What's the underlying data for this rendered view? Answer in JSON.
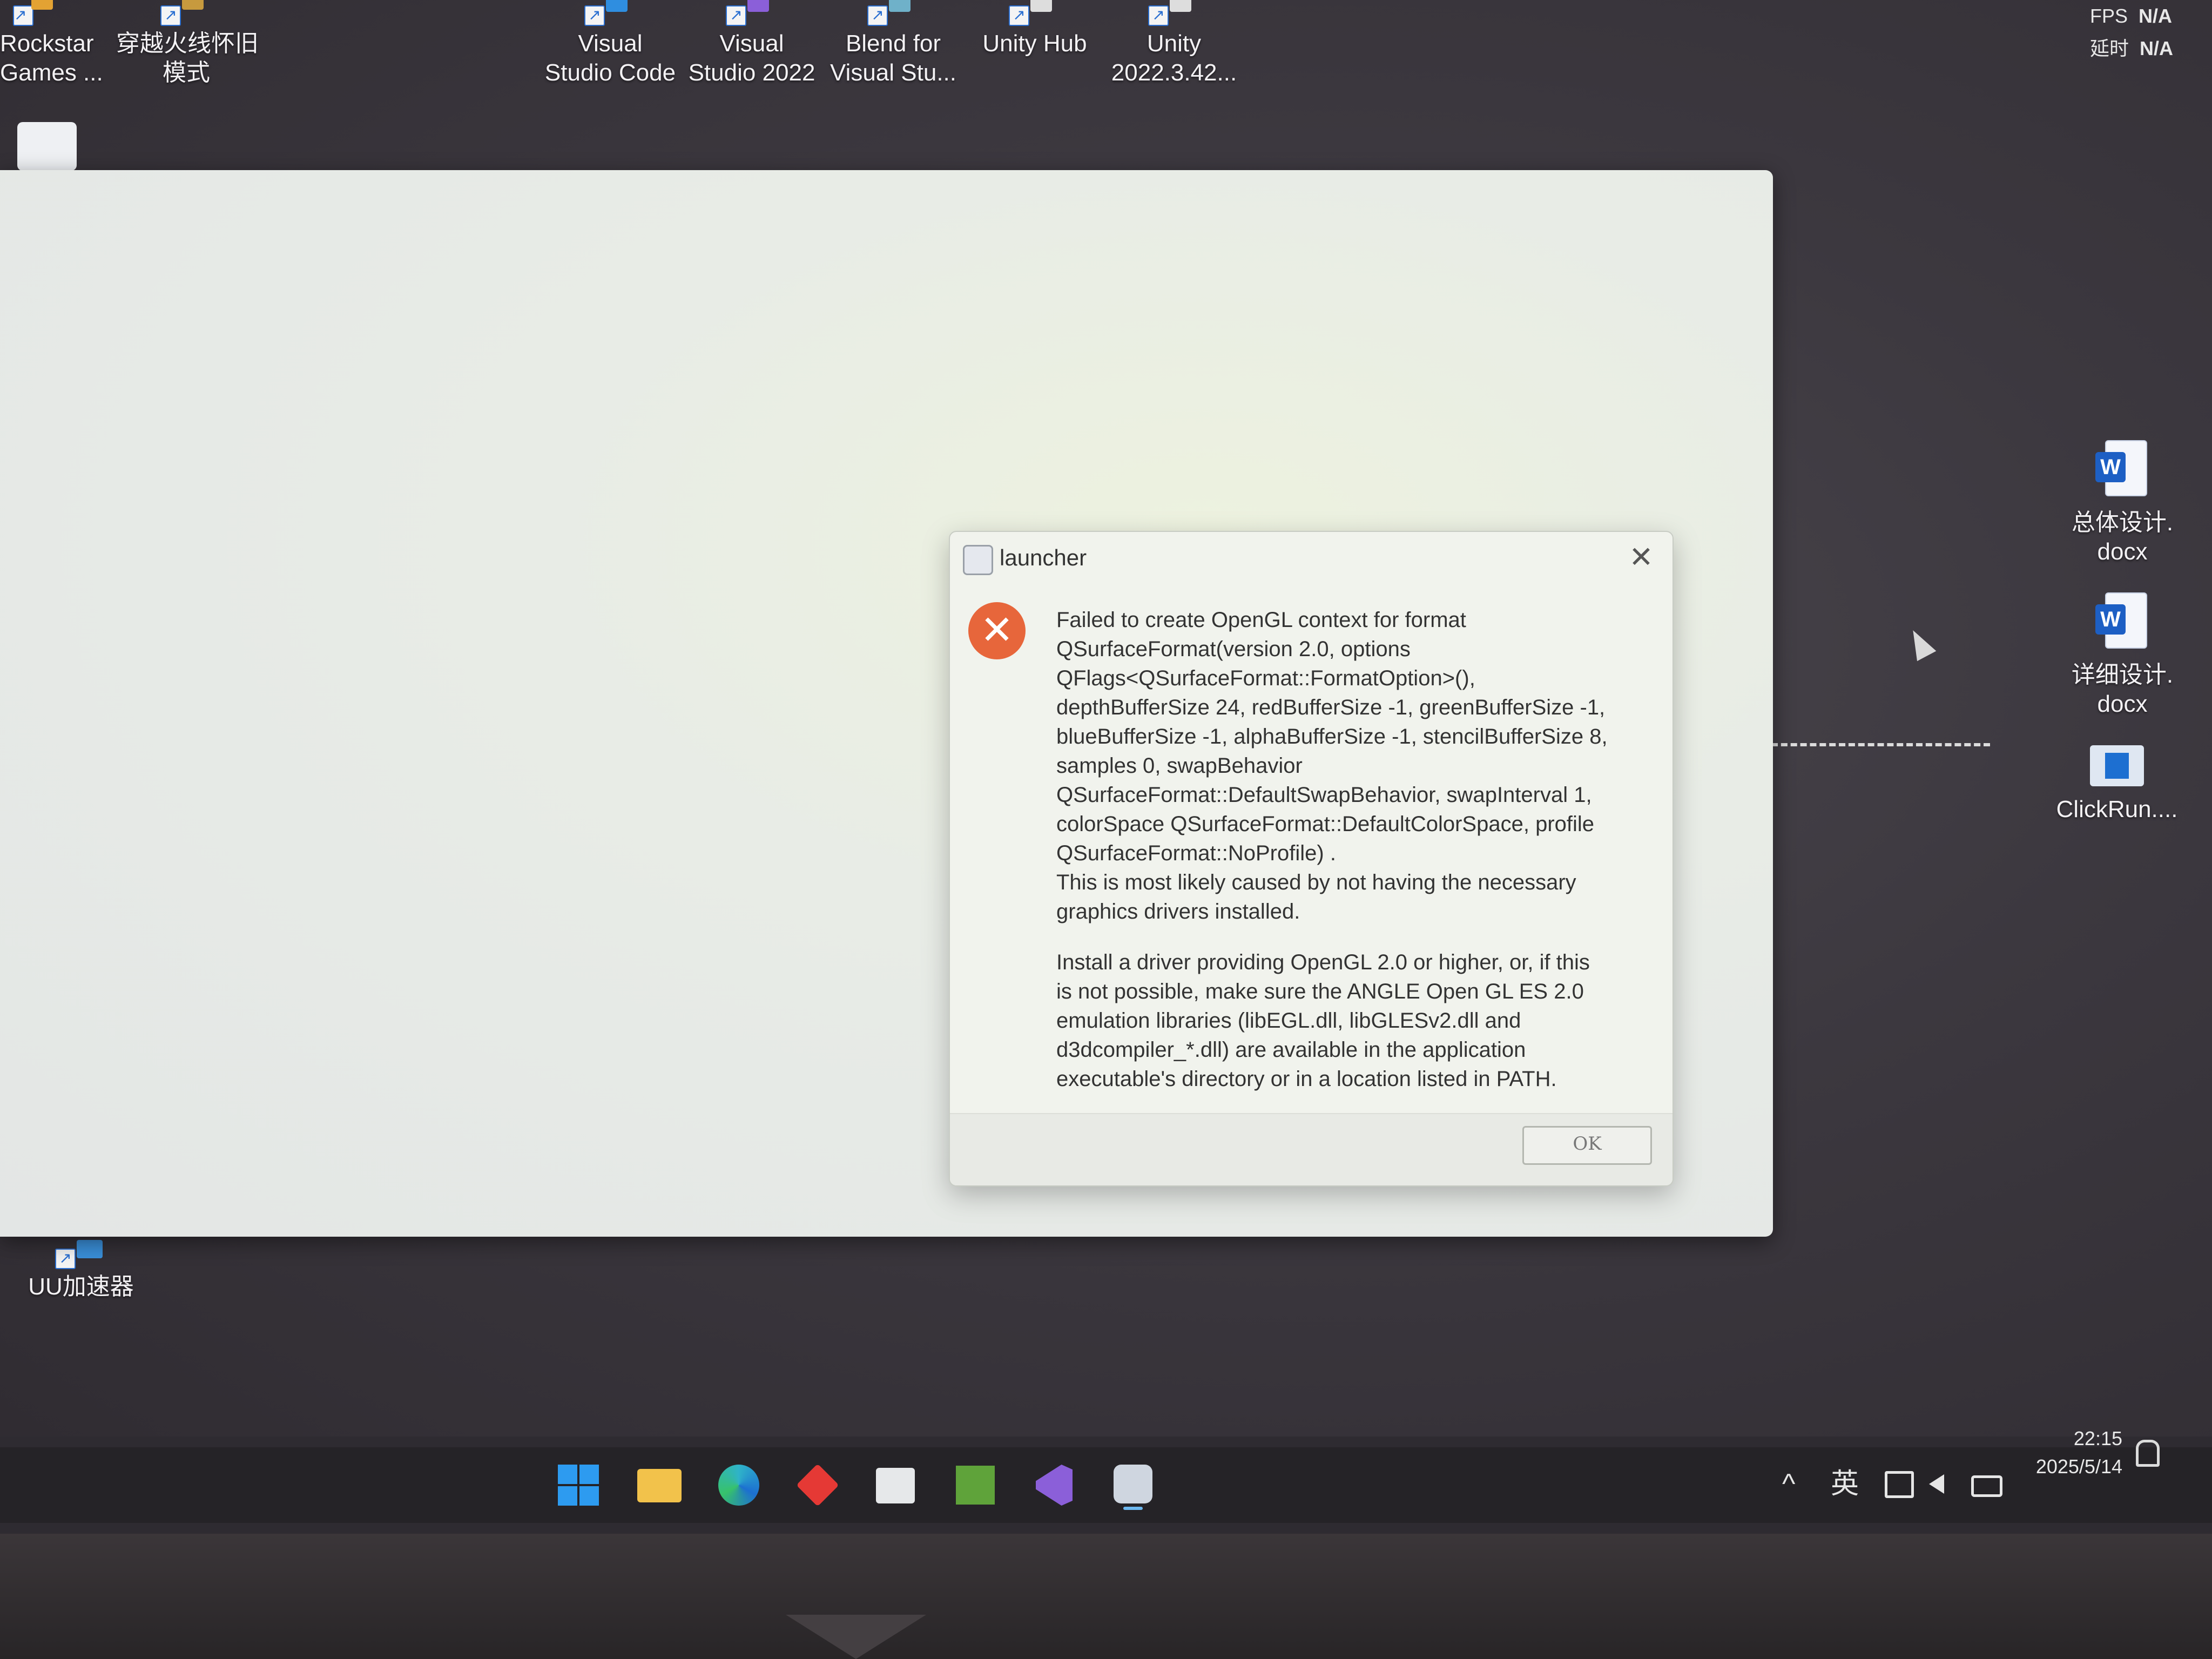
{
  "desktop": {
    "top_icons": [
      {
        "label": "Rockstar\nGames ...",
        "icon": "rockstar-icon"
      },
      {
        "label": "穿越火线怀旧\n模式",
        "icon": "crossfire-icon"
      },
      {
        "label": "Visual\nStudio Code",
        "icon": "vscode-icon"
      },
      {
        "label": "Visual\nStudio 2022",
        "icon": "visual-studio-icon"
      },
      {
        "label": "Blend for\nVisual Stu...",
        "icon": "blend-icon"
      },
      {
        "label": "Unity Hub",
        "icon": "unity-hub-icon"
      },
      {
        "label": "Unity\n2022.3.42...",
        "icon": "unity-icon"
      }
    ],
    "right_icons": [
      {
        "label": "总体设计.\ndocx",
        "icon": "word-doc-icon"
      },
      {
        "label": "详细设计.\ndocx",
        "icon": "word-doc-icon"
      },
      {
        "label": "ClickRun....",
        "icon": "clickrun-icon"
      }
    ],
    "left_bottom_icon": {
      "label": "UU加速器",
      "icon": "uu-accelerator-icon"
    }
  },
  "overlay": {
    "fps_label": "FPS",
    "fps_value": "N/A",
    "latency_label": "延时",
    "latency_value": "N/A"
  },
  "dialog": {
    "title": "launcher",
    "message_1": "Failed to create OpenGL context for format\nQSurfaceFormat(version 2.0, options\nQFlags<QSurfaceFormat::FormatOption>(),\ndepthBufferSize 24, redBufferSize -1, greenBufferSize -1,\nblueBufferSize -1, alphaBufferSize -1, stencilBufferSize 8,\nsamples 0, swapBehavior\nQSurfaceFormat::DefaultSwapBehavior, swapInterval 1,\ncolorSpace QSurfaceFormat::DefaultColorSpace, profile\nQSurfaceFormat::NoProfile) .\nThis is most likely caused by not having the necessary\ngraphics drivers installed.",
    "message_2": "Install a driver providing OpenGL 2.0 or higher, or, if this\nis not possible, make sure the ANGLE Open GL ES 2.0\nemulation libraries (libEGL.dll, libGLESv2.dll and\nd3dcompiler_*.dll) are available in the application\nexecutable's directory or in a location listed in PATH.",
    "ok_label": "OK",
    "close_glyph": "✕",
    "error_glyph": "✕"
  },
  "taskbar": {
    "apps": [
      {
        "name": "start-button",
        "icon": "windows-logo-icon",
        "color": "#2d9bf0"
      },
      {
        "name": "file-explorer",
        "icon": "folder-icon",
        "color": "#f2c24b"
      },
      {
        "name": "edge",
        "icon": "edge-icon",
        "color": "#2fb3c9"
      },
      {
        "name": "app-red",
        "icon": "red-diamond-icon",
        "color": "#e53935"
      },
      {
        "name": "microsoft-store",
        "icon": "store-icon",
        "color": "#e0e0e0"
      },
      {
        "name": "minecraft",
        "icon": "minecraft-icon",
        "color": "#5fa33a"
      },
      {
        "name": "visual-studio",
        "icon": "visual-studio-icon",
        "color": "#8b5fd9"
      },
      {
        "name": "launcher",
        "icon": "launcher-app-icon",
        "color": "#cfd6e0"
      }
    ],
    "tray": {
      "chevron": "^",
      "ime": "英",
      "clock_time": "22:15",
      "clock_date": "2025/5/14"
    }
  }
}
